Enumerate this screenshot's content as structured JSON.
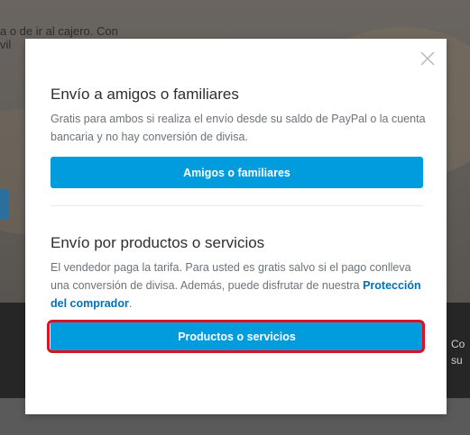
{
  "background": {
    "top_text_line1": "a o de ir al cajero. Con",
    "top_text_line2": "vil",
    "right_text_line1": "Co",
    "right_text_line2": "su"
  },
  "modal": {
    "close_icon": "close-icon",
    "friends_section": {
      "title": "Envío a amigos o familiares",
      "description": "Gratis para ambos si realiza el envío desde su saldo de PayPal o la cuenta bancaria y no hay conversión de divisa.",
      "button_label": "Amigos o familiares"
    },
    "goods_section": {
      "title": "Envío por productos o servicios",
      "description": "El vendedor paga la tarifa. Para usted es gratis salvo si el pago conlleva una conversión de divisa. Además, puede disfrutar de nuestra",
      "link_text": "Protección del comprador",
      "trailing_text": ".",
      "button_label": "Productos o servicios"
    }
  },
  "colors": {
    "primary_button": "#009cde",
    "link": "#0070ba",
    "highlight": "#e0101f"
  }
}
